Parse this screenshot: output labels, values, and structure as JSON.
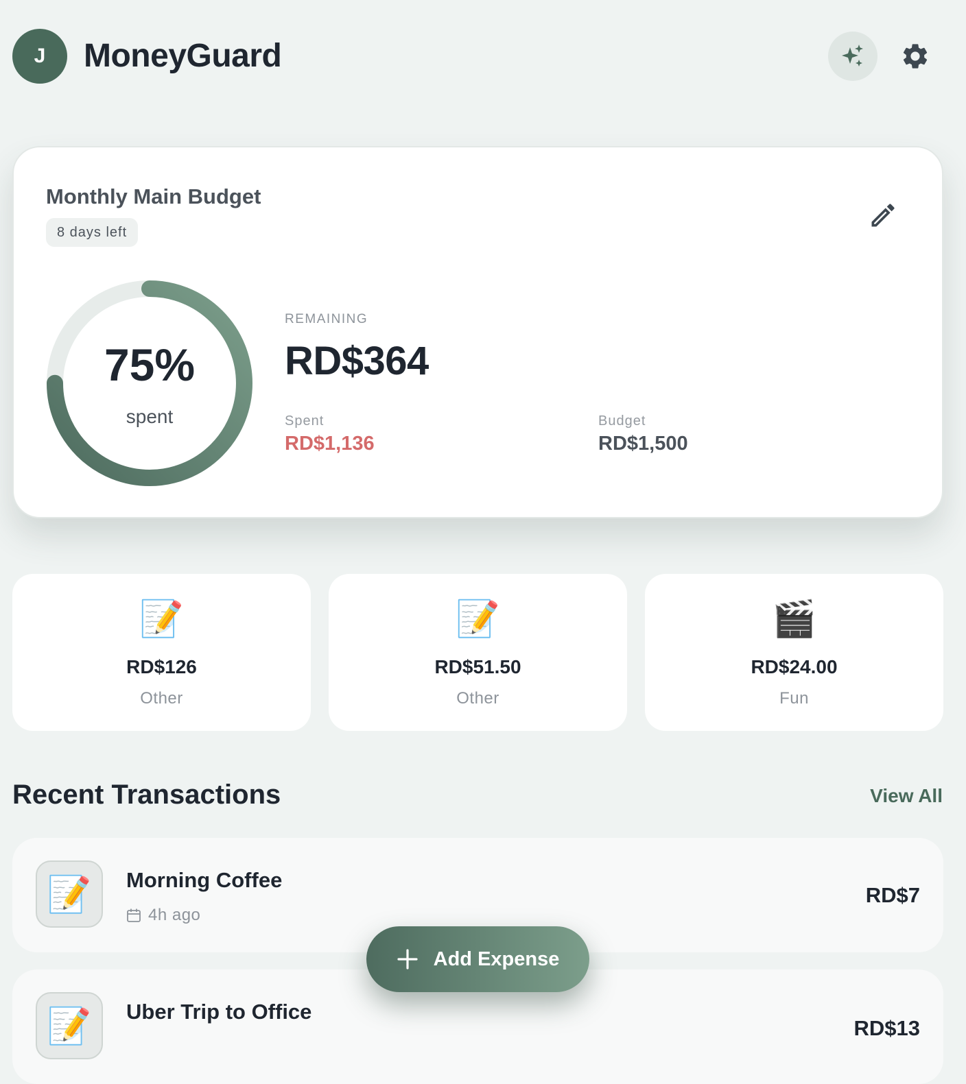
{
  "header": {
    "avatar_initial": "J",
    "app_title": "MoneyGuard",
    "ai_icon": "sparkles-icon",
    "settings_icon": "gear-icon"
  },
  "budget": {
    "title": "Monthly Main Budget",
    "days_left": "8 days left",
    "percent_label": "75%",
    "percent_value": 0.75,
    "spent_caption": "spent",
    "remaining_label": "REMAINING",
    "remaining_value": "RD$364",
    "spent_label": "Spent",
    "spent_value": "RD$1,136",
    "budget_label": "Budget",
    "budget_value": "RD$1,500",
    "edit_icon": "pencil-icon"
  },
  "categories": [
    {
      "icon": "📝",
      "amount": "RD$126",
      "label": "Other"
    },
    {
      "icon": "📝",
      "amount": "RD$51.50",
      "label": "Other"
    },
    {
      "icon": "🎬",
      "amount": "RD$24.00",
      "label": "Fun"
    }
  ],
  "transactions_section": {
    "title": "Recent Transactions",
    "view_all": "View All"
  },
  "transactions": [
    {
      "icon": "📝",
      "name": "Morning Coffee",
      "time": "4h ago",
      "amount": "RD$7"
    },
    {
      "icon": "📝",
      "name": "Uber Trip to Office",
      "time": "",
      "amount": "RD$13"
    }
  ],
  "fab": {
    "label": "Add Expense",
    "icon": "plus-icon"
  },
  "colors": {
    "background": "#eff3f2",
    "accent": "#496a5b",
    "spent": "#d46a6a"
  }
}
